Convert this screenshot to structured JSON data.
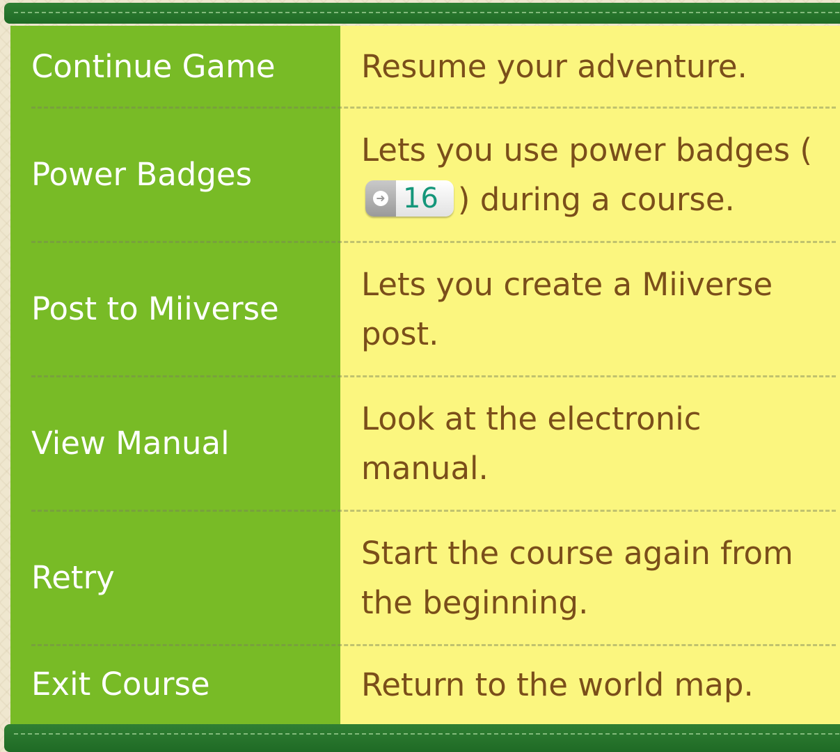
{
  "rows": [
    {
      "label": "Continue Game",
      "desc": "Resume your adventure."
    },
    {
      "label": "Power Badges",
      "desc_before": "Lets you use power badges (",
      "badge_number": "16",
      "desc_after": ") during a course."
    },
    {
      "label": "Post to Miiverse",
      "desc": "Lets you create a Miiverse post."
    },
    {
      "label": "View Manual",
      "desc": "Look at the electronic manual."
    },
    {
      "label": "Retry",
      "desc": "Start the course again from the beginning."
    },
    {
      "label": "Exit Course",
      "desc": "Return to the world map."
    }
  ],
  "colors": {
    "label_column": "#78bb26",
    "desc_column": "#fbf67f",
    "desc_text": "#7a4e1a",
    "frame_bar": "#2f7f33",
    "badge_number": "#14967a"
  },
  "icons": {
    "badge": "arrow-right-icon"
  }
}
